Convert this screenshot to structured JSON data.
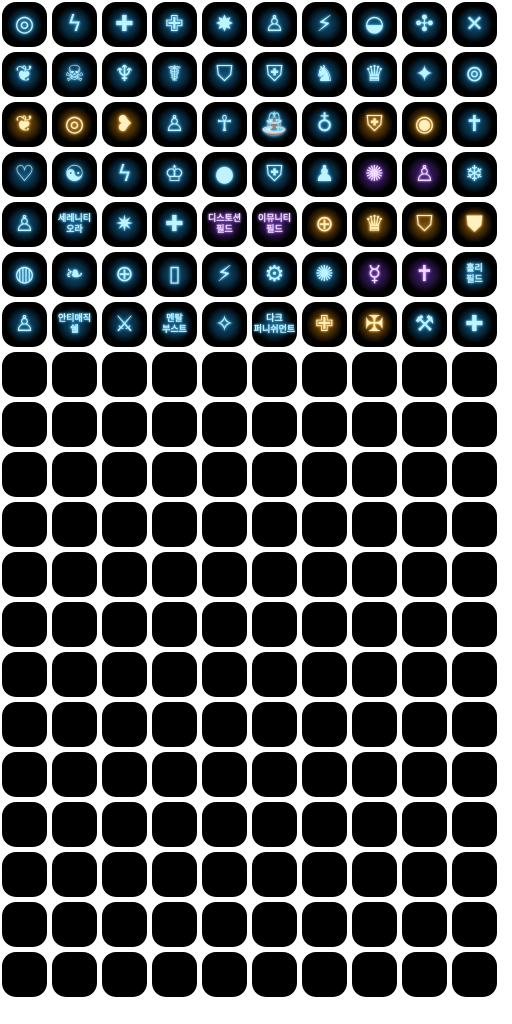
{
  "themes": {
    "b": {
      "fg": "#bff4ff",
      "glow": "#1a8fd6"
    },
    "p": {
      "fg": "#f2d9ff",
      "glow": "#7a3ad0"
    },
    "g": {
      "fg": "#fff0c0",
      "glow": "#d98a10"
    }
  },
  "icons": [
    {
      "name": "swirl",
      "theme": "b",
      "glyph": "◎"
    },
    {
      "name": "lightning-hand",
      "theme": "b",
      "glyph": "ϟ"
    },
    {
      "name": "holy-cross-pillar",
      "theme": "b",
      "glyph": "✚"
    },
    {
      "name": "cross-wings",
      "theme": "b",
      "glyph": "✙"
    },
    {
      "name": "burst",
      "theme": "b",
      "glyph": "✸"
    },
    {
      "name": "figure",
      "theme": "b",
      "glyph": "♙"
    },
    {
      "name": "lightning-figure",
      "theme": "b",
      "glyph": "⚡"
    },
    {
      "name": "shell",
      "theme": "b",
      "glyph": "◒"
    },
    {
      "name": "spark-chain",
      "theme": "b",
      "glyph": "✣"
    },
    {
      "name": "cross-x",
      "theme": "b",
      "glyph": "✕"
    },
    {
      "name": "wing",
      "theme": "b",
      "glyph": "❦"
    },
    {
      "name": "skull",
      "theme": "b",
      "glyph": "☠"
    },
    {
      "name": "triple-cross",
      "theme": "b",
      "glyph": "♆"
    },
    {
      "name": "angel",
      "theme": "b",
      "glyph": "☤"
    },
    {
      "name": "shield",
      "theme": "b",
      "glyph": "⛉"
    },
    {
      "name": "shield-cross",
      "theme": "b",
      "glyph": "⛨"
    },
    {
      "name": "dragon",
      "theme": "b",
      "glyph": "♞"
    },
    {
      "name": "crown-cross",
      "theme": "b",
      "glyph": "♛"
    },
    {
      "name": "star-ring",
      "theme": "b",
      "glyph": "✦"
    },
    {
      "name": "shield-ring",
      "theme": "b",
      "glyph": "⊚"
    },
    {
      "name": "gold-wing",
      "theme": "g",
      "glyph": "❦"
    },
    {
      "name": "gold-swirl",
      "theme": "g",
      "glyph": "◎"
    },
    {
      "name": "gold-heart",
      "theme": "g",
      "glyph": "❥"
    },
    {
      "name": "figure-ring",
      "theme": "b",
      "glyph": "♙"
    },
    {
      "name": "ankh",
      "theme": "b",
      "glyph": "☥"
    },
    {
      "name": "fountain",
      "theme": "b",
      "glyph": "⛲"
    },
    {
      "name": "pedestal",
      "theme": "b",
      "glyph": "♁"
    },
    {
      "name": "halo-shield",
      "theme": "g",
      "glyph": "⛨"
    },
    {
      "name": "gold-ring",
      "theme": "g",
      "glyph": "◉"
    },
    {
      "name": "cross-tablet",
      "theme": "b",
      "glyph": "✝"
    },
    {
      "name": "broken-heart",
      "theme": "b",
      "glyph": "♡"
    },
    {
      "name": "figure-circle",
      "theme": "b",
      "glyph": "☯"
    },
    {
      "name": "bolt-ring",
      "theme": "b",
      "glyph": "ϟ"
    },
    {
      "name": "bolt-crown",
      "theme": "b",
      "glyph": "♔"
    },
    {
      "name": "orb",
      "theme": "b",
      "glyph": "●"
    },
    {
      "name": "shield-wings",
      "theme": "b",
      "glyph": "⛨"
    },
    {
      "name": "silhouette",
      "theme": "b",
      "glyph": "♟"
    },
    {
      "name": "purple-eye",
      "theme": "p",
      "glyph": "✺"
    },
    {
      "name": "purple-figure",
      "theme": "p",
      "glyph": "♙"
    },
    {
      "name": "snowflake-orb",
      "theme": "b",
      "glyph": "❄"
    },
    {
      "name": "figure-arms",
      "theme": "b",
      "glyph": "♙"
    },
    {
      "name": "text",
      "theme": "b",
      "label": "세레니티\n오라"
    },
    {
      "name": "star-burst",
      "theme": "b",
      "glyph": "✷"
    },
    {
      "name": "cross-figure",
      "theme": "b",
      "glyph": "✚"
    },
    {
      "name": "text",
      "theme": "p",
      "label": "디스토션\n필드"
    },
    {
      "name": "text",
      "theme": "p",
      "label": "이뮤니티\n필드"
    },
    {
      "name": "sun-shield",
      "theme": "g",
      "glyph": "⊕"
    },
    {
      "name": "crown-shield",
      "theme": "g",
      "glyph": "♛"
    },
    {
      "name": "gold-shield",
      "theme": "g",
      "glyph": "⛉"
    },
    {
      "name": "gold-stack-shield",
      "theme": "g",
      "glyph": "⛊"
    },
    {
      "name": "ring-shield",
      "theme": "b",
      "glyph": "◍"
    },
    {
      "name": "feather",
      "theme": "b",
      "glyph": "❧"
    },
    {
      "name": "cross-target",
      "theme": "b",
      "glyph": "⊕"
    },
    {
      "name": "pillar",
      "theme": "b",
      "glyph": "▯"
    },
    {
      "name": "lightning-scatter",
      "theme": "b",
      "glyph": "⚡"
    },
    {
      "name": "gear-slash",
      "theme": "b",
      "glyph": "⚙"
    },
    {
      "name": "spark-fountain",
      "theme": "b",
      "glyph": "✺"
    },
    {
      "name": "purple-dancer",
      "theme": "p",
      "glyph": "☿"
    },
    {
      "name": "purple-cross",
      "theme": "p",
      "glyph": "✝"
    },
    {
      "name": "text",
      "theme": "b",
      "label": "홀리\n필드"
    },
    {
      "name": "figure-halo",
      "theme": "b",
      "glyph": "♙"
    },
    {
      "name": "text",
      "theme": "b",
      "label": "안티매직\n쉘"
    },
    {
      "name": "crossed-swords",
      "theme": "b",
      "glyph": "⚔"
    },
    {
      "name": "text",
      "theme": "b",
      "label": "멘탈\n부스트"
    },
    {
      "name": "star-figure",
      "theme": "b",
      "glyph": "✧"
    },
    {
      "name": "text",
      "theme": "b",
      "label": "다크\n퍼니쉬먼트"
    },
    {
      "name": "holy-drop",
      "theme": "g",
      "glyph": "✙"
    },
    {
      "name": "gold-cross-swirl",
      "theme": "g",
      "glyph": "✠"
    },
    {
      "name": "hammer-figure",
      "theme": "b",
      "glyph": "⚒"
    },
    {
      "name": "cross-figure-2",
      "theme": "b",
      "glyph": "✚"
    }
  ],
  "empty_slots": 130
}
